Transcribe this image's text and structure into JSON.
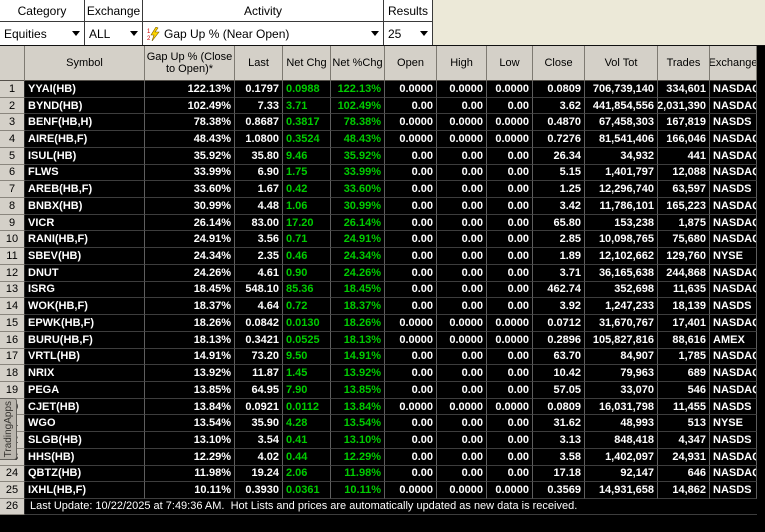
{
  "window": {
    "side_tab_label": "TradingApps"
  },
  "toolbar": {
    "category": {
      "label": "Category",
      "value": "Equities"
    },
    "exchange": {
      "label": "Exchange",
      "value": "ALL"
    },
    "activity": {
      "label": "Activity",
      "value": "Gap Up % (Near Open)",
      "icon": "link-lightning-icon"
    },
    "results": {
      "label": "Results",
      "value": "25"
    }
  },
  "colors": {
    "up_green": "#00cc00",
    "header_bg": "#d4d0c8",
    "table_bg": "#000000"
  },
  "table": {
    "columns": [
      "Symbol",
      "Gap Up % (Close to Open)*",
      "Last",
      "Net Chg",
      "Net %Chg",
      "Open",
      "High",
      "Low",
      "Close",
      "Vol Tot",
      "Trades",
      "Exchange"
    ],
    "rows": [
      {
        "num": "1",
        "symbol": "YYAI(HB)",
        "gap": "122.13%",
        "last": "0.1797",
        "net_chg": "0.0988",
        "net_pct": "122.13%",
        "open": "0.0000",
        "high": "0.0000",
        "low": "0.0000",
        "close": "0.0809",
        "vol_tot": "706,739,140",
        "trades": "334,601",
        "exchange": "NASDAQ"
      },
      {
        "num": "2",
        "symbol": "BYND(HB)",
        "gap": "102.49%",
        "last": "7.33",
        "net_chg": "3.71",
        "net_pct": "102.49%",
        "open": "0.00",
        "high": "0.00",
        "low": "0.00",
        "close": "3.62",
        "vol_tot": "441,854,556",
        "trades": "2,031,390",
        "exchange": "NASDAQ"
      },
      {
        "num": "3",
        "symbol": "BENF(HB,H)",
        "gap": "78.38%",
        "last": "0.8687",
        "net_chg": "0.3817",
        "net_pct": "78.38%",
        "open": "0.0000",
        "high": "0.0000",
        "low": "0.0000",
        "close": "0.4870",
        "vol_tot": "67,458,303",
        "trades": "167,819",
        "exchange": "NASDS"
      },
      {
        "num": "4",
        "symbol": "AIRE(HB,F)",
        "gap": "48.43%",
        "last": "1.0800",
        "net_chg": "0.3524",
        "net_pct": "48.43%",
        "open": "0.0000",
        "high": "0.0000",
        "low": "0.0000",
        "close": "0.7276",
        "vol_tot": "81,541,406",
        "trades": "166,046",
        "exchange": "NASDAQ"
      },
      {
        "num": "5",
        "symbol": "ISUL(HB)",
        "gap": "35.92%",
        "last": "35.80",
        "net_chg": "9.46",
        "net_pct": "35.92%",
        "open": "0.00",
        "high": "0.00",
        "low": "0.00",
        "close": "26.34",
        "vol_tot": "34,932",
        "trades": "441",
        "exchange": "NASDAQ"
      },
      {
        "num": "6",
        "symbol": "FLWS",
        "gap": "33.99%",
        "last": "6.90",
        "net_chg": "1.75",
        "net_pct": "33.99%",
        "open": "0.00",
        "high": "0.00",
        "low": "0.00",
        "close": "5.15",
        "vol_tot": "1,401,797",
        "trades": "12,088",
        "exchange": "NASDAQ"
      },
      {
        "num": "7",
        "symbol": "AREB(HB,F)",
        "gap": "33.60%",
        "last": "1.67",
        "net_chg": "0.42",
        "net_pct": "33.60%",
        "open": "0.00",
        "high": "0.00",
        "low": "0.00",
        "close": "1.25",
        "vol_tot": "12,296,740",
        "trades": "63,597",
        "exchange": "NASDS"
      },
      {
        "num": "8",
        "symbol": "BNBX(HB)",
        "gap": "30.99%",
        "last": "4.48",
        "net_chg": "1.06",
        "net_pct": "30.99%",
        "open": "0.00",
        "high": "0.00",
        "low": "0.00",
        "close": "3.42",
        "vol_tot": "11,786,101",
        "trades": "165,223",
        "exchange": "NASDAQ"
      },
      {
        "num": "9",
        "symbol": "VICR",
        "gap": "26.14%",
        "last": "83.00",
        "net_chg": "17.20",
        "net_pct": "26.14%",
        "open": "0.00",
        "high": "0.00",
        "low": "0.00",
        "close": "65.80",
        "vol_tot": "153,238",
        "trades": "1,875",
        "exchange": "NASDAQ"
      },
      {
        "num": "10",
        "symbol": "RANI(HB,F)",
        "gap": "24.91%",
        "last": "3.56",
        "net_chg": "0.71",
        "net_pct": "24.91%",
        "open": "0.00",
        "high": "0.00",
        "low": "0.00",
        "close": "2.85",
        "vol_tot": "10,098,765",
        "trades": "75,680",
        "exchange": "NASDAQ"
      },
      {
        "num": "11",
        "symbol": "SBEV(HB)",
        "gap": "24.34%",
        "last": "2.35",
        "net_chg": "0.46",
        "net_pct": "24.34%",
        "open": "0.00",
        "high": "0.00",
        "low": "0.00",
        "close": "1.89",
        "vol_tot": "12,102,662",
        "trades": "129,760",
        "exchange": "NYSE"
      },
      {
        "num": "12",
        "symbol": "DNUT",
        "gap": "24.26%",
        "last": "4.61",
        "net_chg": "0.90",
        "net_pct": "24.26%",
        "open": "0.00",
        "high": "0.00",
        "low": "0.00",
        "close": "3.71",
        "vol_tot": "36,165,638",
        "trades": "244,868",
        "exchange": "NASDAQ"
      },
      {
        "num": "13",
        "symbol": "ISRG",
        "gap": "18.45%",
        "last": "548.10",
        "net_chg": "85.36",
        "net_pct": "18.45%",
        "open": "0.00",
        "high": "0.00",
        "low": "0.00",
        "close": "462.74",
        "vol_tot": "352,698",
        "trades": "11,635",
        "exchange": "NASDAQ"
      },
      {
        "num": "14",
        "symbol": "WOK(HB,F)",
        "gap": "18.37%",
        "last": "4.64",
        "net_chg": "0.72",
        "net_pct": "18.37%",
        "open": "0.00",
        "high": "0.00",
        "low": "0.00",
        "close": "3.92",
        "vol_tot": "1,247,233",
        "trades": "18,139",
        "exchange": "NASDS"
      },
      {
        "num": "15",
        "symbol": "EPWK(HB,F)",
        "gap": "18.26%",
        "last": "0.0842",
        "net_chg": "0.0130",
        "net_pct": "18.26%",
        "open": "0.0000",
        "high": "0.0000",
        "low": "0.0000",
        "close": "0.0712",
        "vol_tot": "31,670,767",
        "trades": "17,401",
        "exchange": "NASDAQ"
      },
      {
        "num": "16",
        "symbol": "BURU(HB,F)",
        "gap": "18.13%",
        "last": "0.3421",
        "net_chg": "0.0525",
        "net_pct": "18.13%",
        "open": "0.0000",
        "high": "0.0000",
        "low": "0.0000",
        "close": "0.2896",
        "vol_tot": "105,827,816",
        "trades": "88,616",
        "exchange": "AMEX"
      },
      {
        "num": "17",
        "symbol": "VRTL(HB)",
        "gap": "14.91%",
        "last": "73.20",
        "net_chg": "9.50",
        "net_pct": "14.91%",
        "open": "0.00",
        "high": "0.00",
        "low": "0.00",
        "close": "63.70",
        "vol_tot": "84,907",
        "trades": "1,785",
        "exchange": "NASDAQ"
      },
      {
        "num": "18",
        "symbol": "NRIX",
        "gap": "13.92%",
        "last": "11.87",
        "net_chg": "1.45",
        "net_pct": "13.92%",
        "open": "0.00",
        "high": "0.00",
        "low": "0.00",
        "close": "10.42",
        "vol_tot": "79,963",
        "trades": "689",
        "exchange": "NASDAQ"
      },
      {
        "num": "19",
        "symbol": "PEGA",
        "gap": "13.85%",
        "last": "64.95",
        "net_chg": "7.90",
        "net_pct": "13.85%",
        "open": "0.00",
        "high": "0.00",
        "low": "0.00",
        "close": "57.05",
        "vol_tot": "33,070",
        "trades": "546",
        "exchange": "NASDAQ"
      },
      {
        "num": "20",
        "symbol": "CJET(HB)",
        "gap": "13.84%",
        "last": "0.0921",
        "net_chg": "0.0112",
        "net_pct": "13.84%",
        "open": "0.0000",
        "high": "0.0000",
        "low": "0.0000",
        "close": "0.0809",
        "vol_tot": "16,031,798",
        "trades": "11,455",
        "exchange": "NASDS"
      },
      {
        "num": "21",
        "symbol": "WGO",
        "gap": "13.54%",
        "last": "35.90",
        "net_chg": "4.28",
        "net_pct": "13.54%",
        "open": "0.00",
        "high": "0.00",
        "low": "0.00",
        "close": "31.62",
        "vol_tot": "48,993",
        "trades": "513",
        "exchange": "NYSE"
      },
      {
        "num": "22",
        "symbol": "SLGB(HB)",
        "gap": "13.10%",
        "last": "3.54",
        "net_chg": "0.41",
        "net_pct": "13.10%",
        "open": "0.00",
        "high": "0.00",
        "low": "0.00",
        "close": "3.13",
        "vol_tot": "848,418",
        "trades": "4,347",
        "exchange": "NASDS"
      },
      {
        "num": "23",
        "symbol": "HHS(HB)",
        "gap": "12.29%",
        "last": "4.02",
        "net_chg": "0.44",
        "net_pct": "12.29%",
        "open": "0.00",
        "high": "0.00",
        "low": "0.00",
        "close": "3.58",
        "vol_tot": "1,402,097",
        "trades": "24,931",
        "exchange": "NASDAQ"
      },
      {
        "num": "24",
        "symbol": "QBTZ(HB)",
        "gap": "11.98%",
        "last": "19.24",
        "net_chg": "2.06",
        "net_pct": "11.98%",
        "open": "0.00",
        "high": "0.00",
        "low": "0.00",
        "close": "17.18",
        "vol_tot": "92,147",
        "trades": "646",
        "exchange": "NASDAQ"
      },
      {
        "num": "25",
        "symbol": "IXHL(HB,F)",
        "gap": "10.11%",
        "last": "0.3930",
        "net_chg": "0.0361",
        "net_pct": "10.11%",
        "open": "0.0000",
        "high": "0.0000",
        "low": "0.0000",
        "close": "0.3569",
        "vol_tot": "14,931,658",
        "trades": "14,862",
        "exchange": "NASDS"
      }
    ],
    "status_row": {
      "num": "26",
      "text": "Last Update: 10/22/2025 at 7:49:36 AM.  Hot Lists and prices are automatically updated as new data is received."
    }
  }
}
